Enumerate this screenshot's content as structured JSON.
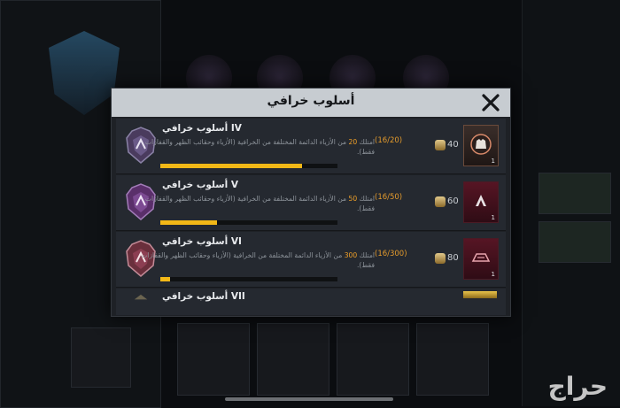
{
  "modal": {
    "title": "أسلوب خرافي"
  },
  "achievements": [
    {
      "name": "أسلوب خرافي IV",
      "desc_prefix": "امتلك",
      "desc_target": "20",
      "desc_suffix": "من الأزياء الدائمة المختلفة من الخرافية (الأزياء وحقائب الظهر والقفازات فقط).",
      "progress_text": "(16/20)",
      "progress_fraction": 0.8,
      "reward_amount": "40",
      "reward_count": "1"
    },
    {
      "name": "أسلوب خرافي V",
      "desc_prefix": "امتلك",
      "desc_target": "50",
      "desc_suffix": "من الأزياء الدائمة المختلفة من الخرافية (الأزياء وحقائب الظهر والقفازات فقط).",
      "progress_text": "(16/50)",
      "progress_fraction": 0.32,
      "reward_amount": "60",
      "reward_count": "1"
    },
    {
      "name": "أسلوب خرافي VI",
      "desc_prefix": "امتلك",
      "desc_target": "300",
      "desc_suffix": "من الأزياء الدائمة المختلفة من الخرافية (الأزياء وحقائب الظهر والقفازات فقط).",
      "progress_text": "(16/300)",
      "progress_fraction": 0.053,
      "reward_amount": "80",
      "reward_count": "1"
    },
    {
      "name": "أسلوب خرافي VII"
    }
  ],
  "watermark": "حراج",
  "icons": {
    "close": "close-icon",
    "medal": "shield-medal-icon",
    "coin": "coin-icon",
    "reward": "outfit-reward-icon"
  },
  "colors": {
    "accent": "#f3b817",
    "highlight": "#f0a028",
    "header": "#c7ccd1"
  }
}
